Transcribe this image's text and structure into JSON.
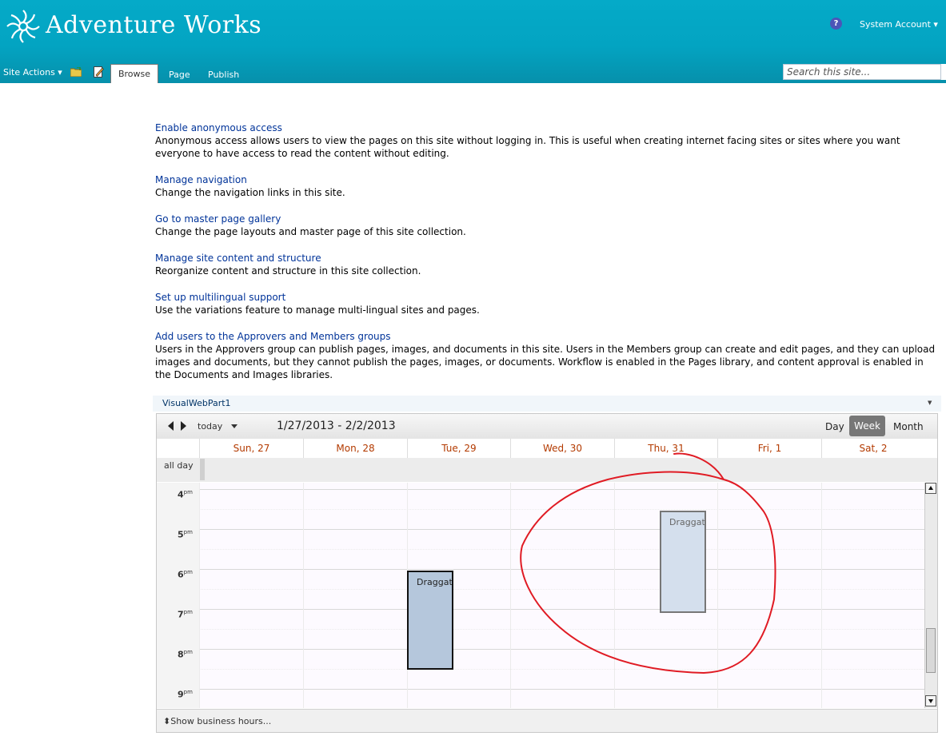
{
  "header": {
    "site_title": "Adventure Works",
    "help_glyph": "?",
    "account": "System Account ▾"
  },
  "ribbon": {
    "site_actions": "Site Actions ▾",
    "tabs": [
      "Browse",
      "Page",
      "Publish"
    ],
    "search_placeholder": "Search this site..."
  },
  "entries": [
    {
      "link": "Enable anonymous access",
      "text": "Anonymous access allows users to view the pages on this site without logging in. This is useful when creating internet facing sites or sites where you want everyone to have access to read the content without editing."
    },
    {
      "link": "Manage navigation",
      "text": "Change the navigation links in this site."
    },
    {
      "link": "Go to master page gallery",
      "text": "Change the page layouts and master page of this site collection."
    },
    {
      "link": "Manage site content and structure",
      "text": "Reorganize content and structure in this site collection."
    },
    {
      "link": "Set up multilingual support",
      "text": "Use the variations feature to manage multi-lingual sites and pages."
    },
    {
      "link": "Add users to the Approvers and Members groups",
      "text": "Users in the Approvers group can publish pages, images, and documents in this site. Users in the Members group can create and edit pages, and they can upload images and documents, but they cannot publish the pages, images, or documents. Workflow is enabled in the Pages library, and content approval is enabled in the Documents and Images libraries."
    }
  ],
  "webpart": {
    "title": "VisualWebPart1",
    "menu_glyph": "▼"
  },
  "calendar": {
    "today_label": "today",
    "date_range": "1/27/2013 - 2/2/2013",
    "views": [
      "Day",
      "Week",
      "Month"
    ],
    "active_view": "Week",
    "days": [
      "Sun, 27",
      "Mon, 28",
      "Tue, 29",
      "Wed, 30",
      "Thu, 31",
      "Fri, 1",
      "Sat, 2"
    ],
    "all_day_label": "all day",
    "hours": [
      {
        "h": "4",
        "ampm": "pm"
      },
      {
        "h": "5",
        "ampm": "pm"
      },
      {
        "h": "6",
        "ampm": "pm"
      },
      {
        "h": "7",
        "ampm": "pm"
      },
      {
        "h": "8",
        "ampm": "pm"
      },
      {
        "h": "9",
        "ampm": "pm"
      }
    ],
    "events": [
      {
        "title": "Draggat",
        "day": "Tue, 29"
      },
      {
        "title": "Draggat",
        "day": "Thu, 31"
      }
    ],
    "footer": "Show business hours..."
  },
  "colors": {
    "header_bg": "#05aac8",
    "link": "#003399",
    "day_header": "#b33a00",
    "annotation": "#e01b24"
  }
}
